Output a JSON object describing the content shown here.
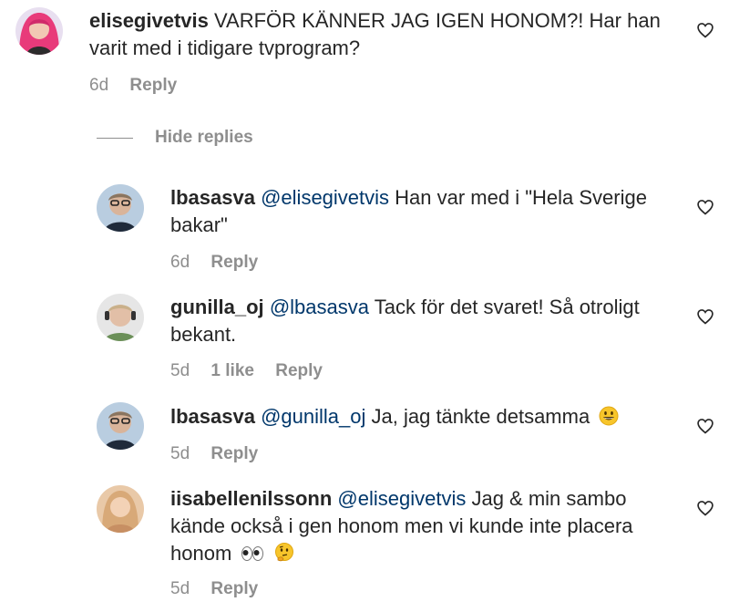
{
  "comments": [
    {
      "username": "elisegivetvis",
      "mention": "",
      "text": "VARFÖR KÄNNER JAG IGEN HONOM?! Har han varit med i tidigare tvprogram?",
      "time": "6d",
      "likes": "",
      "reply_label": "Reply"
    },
    {
      "username": "lbasasva",
      "mention": "@elisegivetvis",
      "text": "Han var med i \"Hela Sverige bakar\"",
      "time": "6d",
      "likes": "",
      "reply_label": "Reply"
    },
    {
      "username": "gunilla_oj",
      "mention": "@lbasasva",
      "text": "Tack för det svaret! Så otroligt bekant.",
      "time": "5d",
      "likes": "1 like",
      "reply_label": "Reply"
    },
    {
      "username": "lbasasva",
      "mention": "@gunilla_oj",
      "text": "Ja, jag tänkte detsamma",
      "time": "5d",
      "likes": "",
      "reply_label": "Reply"
    },
    {
      "username": "iisabellenilssonn",
      "mention": "@elisegivetvis",
      "text": "Jag & min sambo kände också i gen honom men vi kunde inte placera honom",
      "time": "5d",
      "likes": "",
      "reply_label": "Reply"
    }
  ],
  "hide_replies_label": "Hide replies",
  "icons": {
    "like": "heart-outline-icon",
    "grin_emoji": "grinning-face-emoji",
    "eyes_emoji": "eyes-emoji",
    "thinking_emoji": "thinking-face-emoji"
  },
  "colors": {
    "text": "#262626",
    "muted": "#8e8e8e",
    "mention": "#00376b"
  }
}
